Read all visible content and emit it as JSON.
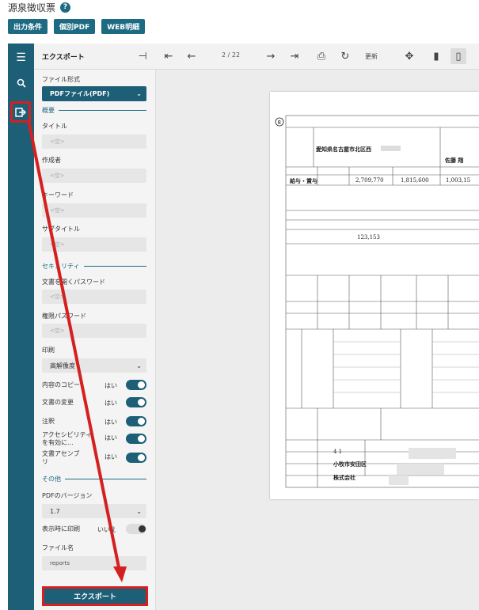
{
  "header": {
    "title": "源泉徴収票",
    "help_icon": "question-icon"
  },
  "top_buttons": [
    "出力条件",
    "個別PDF",
    "WEB明細"
  ],
  "toolbar": {
    "panel_title": "エクスポート",
    "page_indicator": "2 / 22",
    "refresh_label": "更新"
  },
  "panel": {
    "file_format_label": "ファイル形式",
    "file_format_value": "PDFファイル(PDF)",
    "overview_section": "概要",
    "title_label": "タイトル",
    "title_placeholder": "<空>",
    "author_label": "作成者",
    "author_placeholder": "<空>",
    "keyword_label": "キーワード",
    "keyword_placeholder": "<空>",
    "subtitle_label": "サブタイトル",
    "subtitle_placeholder": "<空>",
    "security_section": "セキュリティ",
    "open_password_label": "文書を開くパスワード",
    "open_password_placeholder": "<空>",
    "perm_password_label": "権限パスワード",
    "perm_password_placeholder": "<空>",
    "print_label": "印刷",
    "print_value": "高解像度",
    "toggles": [
      {
        "label": "内容のコピー",
        "value": "はい",
        "on": true
      },
      {
        "label": "文書の変更",
        "value": "はい",
        "on": true
      },
      {
        "label": "注釈",
        "value": "はい",
        "on": true
      },
      {
        "label": "アクセシビリティを有効に...",
        "value": "はい",
        "on": true
      },
      {
        "label": "文書アセンブリ",
        "value": "はい",
        "on": true
      }
    ],
    "other_section": "その他",
    "pdf_version_label": "PDFのバージョン",
    "pdf_version_value": "1.7",
    "print_on_display_label": "表示時に印刷",
    "print_on_display_value": "いいえ",
    "filename_label": "ファイル名",
    "filename_value": "reports",
    "export_button": "エクスポート"
  },
  "document": {
    "address": "愛知県名古屋市北区西",
    "type": "給与・賞与",
    "payment": "2,709,770",
    "after_deduction": "1,815,600",
    "deduction_total": "1,003,15",
    "tax": "123,153",
    "name_partial": "佐藤 翔",
    "address2": "小牧市安田区",
    "company": "株式会社",
    "row_number": "4 1"
  },
  "accent_color": "#1d5f77",
  "annotation_color": "#d42020"
}
